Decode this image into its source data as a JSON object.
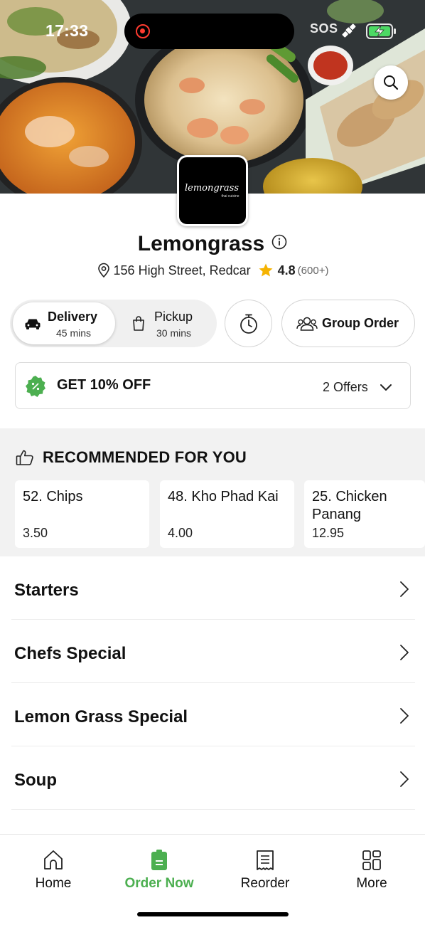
{
  "status_bar": {
    "time": "17:33",
    "sos": "SOS"
  },
  "restaurant": {
    "logo_text": "lemongrass",
    "logo_subtext": "thai cuisine",
    "name": "Lemongrass",
    "address": "156 High Street, Redcar",
    "rating": "4.8",
    "rating_count": "(600+)"
  },
  "order_mode": {
    "delivery": {
      "label": "Delivery",
      "time": "45 mins",
      "selected": true
    },
    "pickup": {
      "label": "Pickup",
      "time": "30 mins",
      "selected": false
    }
  },
  "group_order_label": "Group Order",
  "offer": {
    "title": "GET 10% OFF",
    "count": "2 Offers"
  },
  "recommended": {
    "heading": "RECOMMENDED FOR YOU",
    "items": [
      {
        "name": "52. Chips",
        "price": "3.50"
      },
      {
        "name": "48. Kho Phad Kai",
        "price": "4.00"
      },
      {
        "name": "25. Chicken Panang",
        "price": "12.95"
      }
    ]
  },
  "categories": [
    "Starters",
    "Chefs Special",
    "Lemon Grass Special",
    "Soup"
  ],
  "bottom_nav": [
    {
      "label": "Home",
      "icon": "home-icon",
      "active": false
    },
    {
      "label": "Order Now",
      "icon": "order-bag-icon",
      "active": true
    },
    {
      "label": "Reorder",
      "icon": "receipt-icon",
      "active": false
    },
    {
      "label": "More",
      "icon": "grid-icon",
      "active": false
    }
  ],
  "colors": {
    "accent": "#4caf50",
    "star": "#f5b301",
    "background_grey": "#f2f2f2"
  }
}
